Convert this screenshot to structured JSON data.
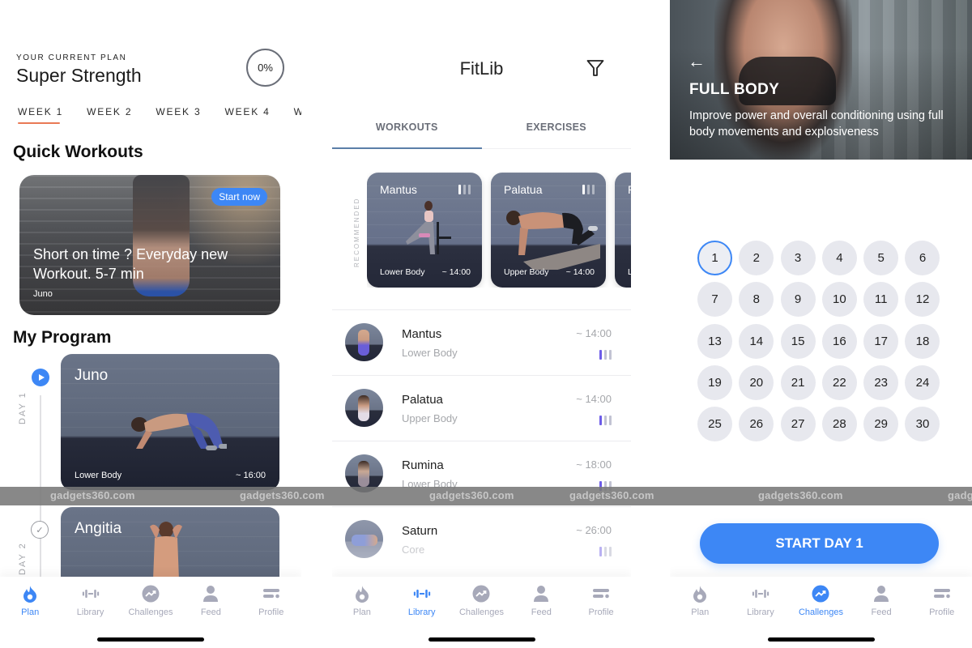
{
  "plan_screen": {
    "kicker": "YOUR CURRENT PLAN",
    "plan_name": "Super Strength",
    "progress": "0%",
    "weeks": [
      "WEEK 1",
      "WEEK 2",
      "WEEK 3",
      "WEEK 4",
      "WEE"
    ],
    "active_week": 0,
    "quick_heading": "Quick Workouts",
    "quick_card": {
      "badge": "Start now",
      "title": "Short on time ? Everyday new Workout. 5-7 min",
      "subtitle": "Juno"
    },
    "program_heading": "My Program",
    "program": [
      {
        "day": "DAY 1",
        "name": "Juno",
        "tag": "Lower Body",
        "time": "~ 16:00",
        "status": "current"
      },
      {
        "day": "DAY 2",
        "name": "Angitia",
        "status": "done"
      }
    ]
  },
  "library_screen": {
    "title": "FitLib",
    "tabs": [
      "WORKOUTS",
      "EXERCISES"
    ],
    "active_tab": 0,
    "recommended_label": "RECOMMENDED",
    "recommended": [
      {
        "name": "Mantus",
        "tag": "Lower Body",
        "time": "~ 14:00",
        "level": 1
      },
      {
        "name": "Palatua",
        "tag": "Upper Body",
        "time": "~ 14:00",
        "level": 1
      },
      {
        "name": "R",
        "tag": "L",
        "time": "",
        "level": 1
      }
    ],
    "workouts": [
      {
        "name": "Mantus",
        "tag": "Lower Body",
        "time": "~ 14:00",
        "level": 1
      },
      {
        "name": "Palatua",
        "tag": "Upper Body",
        "time": "~ 14:00",
        "level": 1
      },
      {
        "name": "Rumina",
        "tag": "Lower Body",
        "time": "~ 18:00",
        "level": 1
      },
      {
        "name": "Saturn",
        "tag": "Core",
        "time": "~ 26:00",
        "level": 1
      }
    ]
  },
  "challenge_screen": {
    "back": "←",
    "title": "FULL BODY",
    "description": "Improve power and overall conditioning using full body movements and explosiveness",
    "days": [
      "1",
      "2",
      "3",
      "4",
      "5",
      "6",
      "7",
      "8",
      "9",
      "10",
      "11",
      "12",
      "13",
      "14",
      "15",
      "16",
      "17",
      "18",
      "19",
      "20",
      "21",
      "22",
      "23",
      "24",
      "25",
      "26",
      "27",
      "28",
      "29",
      "30"
    ],
    "current_day": "1",
    "start_button": "START DAY 1"
  },
  "nav": {
    "items": [
      "Plan",
      "Library",
      "Challenges",
      "Feed",
      "Profile"
    ],
    "active_per_screen": [
      "Plan",
      "Library",
      "Challenges"
    ]
  },
  "watermark": {
    "text": "gadgets360.com"
  },
  "colors": {
    "accent": "#3d87f5",
    "week_underline": "#e97a55",
    "level_active": "#6d5ce8",
    "nav_inactive": "#a7a9b9"
  }
}
